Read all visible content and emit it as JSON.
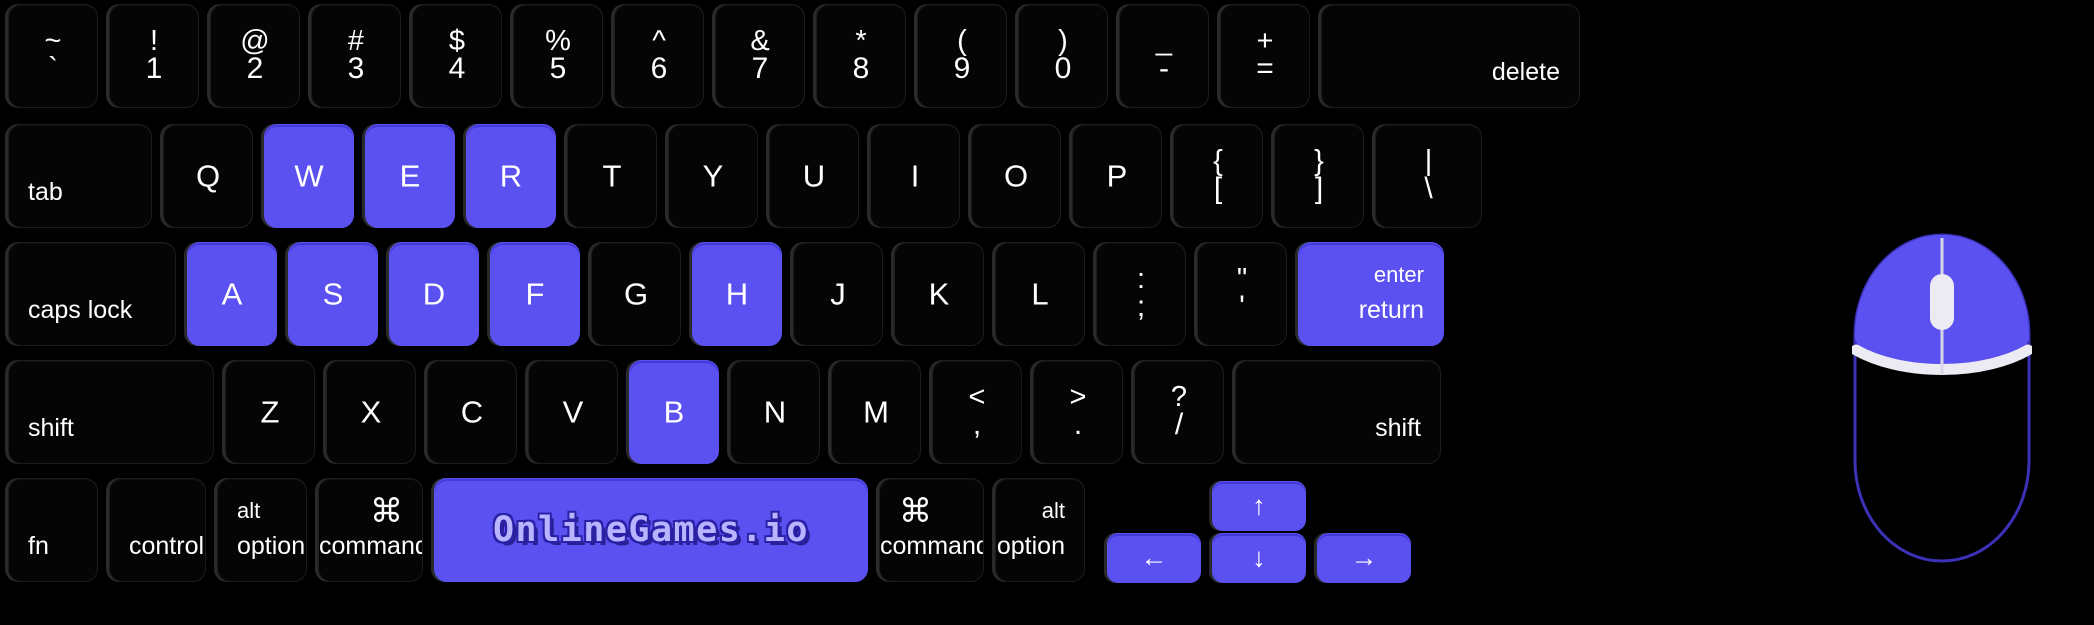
{
  "app": {
    "brand": "OnlineGames.io",
    "widget": "keyboard-and-mouse-controls-overlay"
  },
  "colors": {
    "background": "#000000",
    "key_face": "#050505",
    "key_edge": "#2a2a2a",
    "key_text": "#ffffff",
    "highlight": "#5a51f0",
    "highlight_shadow": "#4239d8",
    "logo_fill": "#b9b4ff",
    "logo_outline": "#2a21a8",
    "mouse_accent": "#ffffff"
  },
  "keyboard": {
    "rows": [
      {
        "name": "number-row",
        "keys": [
          {
            "id": "backquote",
            "top": "~",
            "bottom": "`",
            "highlight": false
          },
          {
            "id": "digit1",
            "top": "!",
            "bottom": "1",
            "highlight": false
          },
          {
            "id": "digit2",
            "top": "@",
            "bottom": "2",
            "highlight": false
          },
          {
            "id": "digit3",
            "top": "#",
            "bottom": "3",
            "highlight": false
          },
          {
            "id": "digit4",
            "top": "$",
            "bottom": "4",
            "highlight": false
          },
          {
            "id": "digit5",
            "top": "%",
            "bottom": "5",
            "highlight": false
          },
          {
            "id": "digit6",
            "top": "^",
            "bottom": "6",
            "highlight": false
          },
          {
            "id": "digit7",
            "top": "&",
            "bottom": "7",
            "highlight": false
          },
          {
            "id": "digit8",
            "top": "*",
            "bottom": "8",
            "highlight": false
          },
          {
            "id": "digit9",
            "top": "(",
            "bottom": "9",
            "highlight": false
          },
          {
            "id": "digit0",
            "top": ")",
            "bottom": "0",
            "highlight": false
          },
          {
            "id": "minus",
            "top": "_",
            "bottom": "-",
            "highlight": false
          },
          {
            "id": "equal",
            "top": "+",
            "bottom": "=",
            "highlight": false
          },
          {
            "id": "delete",
            "label": "delete",
            "highlight": false
          }
        ]
      },
      {
        "name": "top-letter-row",
        "keys": [
          {
            "id": "tab",
            "label": "tab",
            "highlight": false
          },
          {
            "id": "q",
            "label": "Q",
            "highlight": false
          },
          {
            "id": "w",
            "label": "W",
            "highlight": true
          },
          {
            "id": "e",
            "label": "E",
            "highlight": true
          },
          {
            "id": "r",
            "label": "R",
            "highlight": true
          },
          {
            "id": "t",
            "label": "T",
            "highlight": false
          },
          {
            "id": "y",
            "label": "Y",
            "highlight": false
          },
          {
            "id": "u",
            "label": "U",
            "highlight": false
          },
          {
            "id": "i",
            "label": "I",
            "highlight": false
          },
          {
            "id": "o",
            "label": "O",
            "highlight": false
          },
          {
            "id": "p",
            "label": "P",
            "highlight": false
          },
          {
            "id": "bracketleft",
            "top": "{",
            "bottom": "[",
            "highlight": false
          },
          {
            "id": "bracketright",
            "top": "}",
            "bottom": "]",
            "highlight": false
          },
          {
            "id": "backslash",
            "top": "|",
            "bottom": "\\",
            "highlight": false
          }
        ]
      },
      {
        "name": "home-row",
        "keys": [
          {
            "id": "capslock",
            "label": "caps lock",
            "highlight": false
          },
          {
            "id": "a",
            "label": "A",
            "highlight": true
          },
          {
            "id": "s",
            "label": "S",
            "highlight": true
          },
          {
            "id": "d",
            "label": "D",
            "highlight": true
          },
          {
            "id": "f",
            "label": "F",
            "highlight": true
          },
          {
            "id": "g",
            "label": "G",
            "highlight": false
          },
          {
            "id": "h",
            "label": "H",
            "highlight": true
          },
          {
            "id": "j",
            "label": "J",
            "highlight": false
          },
          {
            "id": "k",
            "label": "K",
            "highlight": false
          },
          {
            "id": "l",
            "label": "L",
            "highlight": false
          },
          {
            "id": "semicolon",
            "top": ":",
            "bottom": ";",
            "highlight": false
          },
          {
            "id": "quote",
            "top": "\"",
            "bottom": "'",
            "highlight": false
          },
          {
            "id": "return",
            "top": "enter",
            "bottom": "return",
            "highlight": true
          }
        ]
      },
      {
        "name": "bottom-letter-row",
        "keys": [
          {
            "id": "shiftleft",
            "label": "shift",
            "highlight": false
          },
          {
            "id": "z",
            "label": "Z",
            "highlight": false
          },
          {
            "id": "x",
            "label": "X",
            "highlight": false
          },
          {
            "id": "c",
            "label": "C",
            "highlight": false
          },
          {
            "id": "v",
            "label": "V",
            "highlight": false
          },
          {
            "id": "b",
            "label": "B",
            "highlight": true
          },
          {
            "id": "n",
            "label": "N",
            "highlight": false
          },
          {
            "id": "m",
            "label": "M",
            "highlight": false
          },
          {
            "id": "comma",
            "top": "<",
            "bottom": ",",
            "highlight": false
          },
          {
            "id": "period",
            "top": ">",
            "bottom": ".",
            "highlight": false
          },
          {
            "id": "slash",
            "top": "?",
            "bottom": "/",
            "highlight": false
          },
          {
            "id": "shiftright",
            "label": "shift",
            "highlight": false
          }
        ]
      },
      {
        "name": "modifier-row",
        "keys": [
          {
            "id": "fn",
            "label": "fn",
            "highlight": false
          },
          {
            "id": "controlleft",
            "label": "control",
            "highlight": false
          },
          {
            "id": "optionleft",
            "top": "alt",
            "bottom": "option",
            "highlight": false
          },
          {
            "id": "commandleft",
            "symbol": "⌘",
            "bottom": "command",
            "highlight": false
          },
          {
            "id": "space",
            "label": "OnlineGames.io",
            "highlight": true
          },
          {
            "id": "commandright",
            "symbol": "⌘",
            "bottom": "command",
            "highlight": false
          },
          {
            "id": "optionright",
            "top": "alt",
            "bottom": "option",
            "highlight": false
          },
          {
            "id": "arrowleft",
            "label": "←",
            "highlight": true
          },
          {
            "id": "arrowup",
            "label": "↑",
            "highlight": true
          },
          {
            "id": "arrowdown",
            "label": "↓",
            "highlight": true
          },
          {
            "id": "arrowright",
            "label": "→",
            "highlight": true
          }
        ]
      }
    ]
  },
  "mouse": {
    "name": "computer-mouse",
    "left_button_highlight": true,
    "right_button_highlight": true,
    "scroll_wheel_highlight": false,
    "body_highlight": false
  }
}
